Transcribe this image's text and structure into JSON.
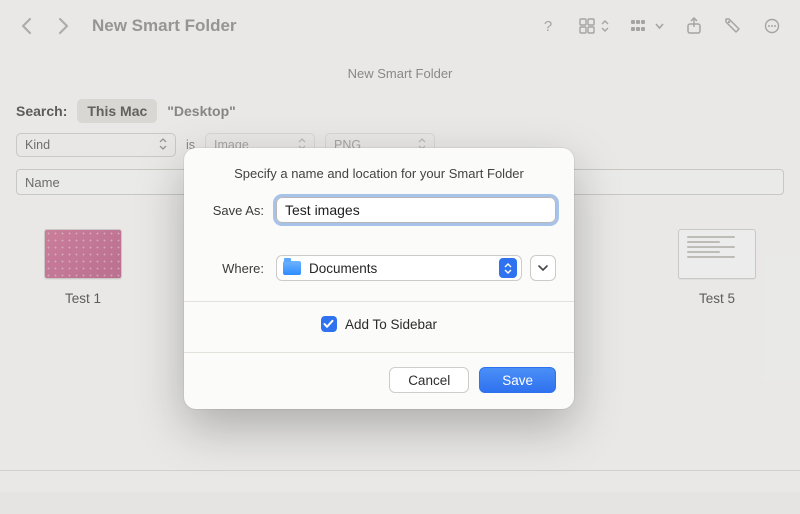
{
  "toolbar": {
    "title": "New Smart Folder"
  },
  "subtitle": "New Smart Folder",
  "search": {
    "label": "Search:",
    "scope_primary": "This Mac",
    "scope_secondary": "\"Desktop\""
  },
  "criteria": {
    "attr": "Kind",
    "verb": "is",
    "value": "Image",
    "sub": "PNG"
  },
  "namebar": {
    "label": "Name"
  },
  "files": {
    "left": {
      "name": "Test 1"
    },
    "right": {
      "name": "Test 5"
    }
  },
  "sheet": {
    "title": "Specify a name and location for your Smart Folder",
    "save_as_label": "Save As:",
    "save_as_value": "Test images",
    "where_label": "Where:",
    "where_value": "Documents",
    "sidebar_checkbox": "Add To Sidebar",
    "cancel": "Cancel",
    "save": "Save"
  }
}
